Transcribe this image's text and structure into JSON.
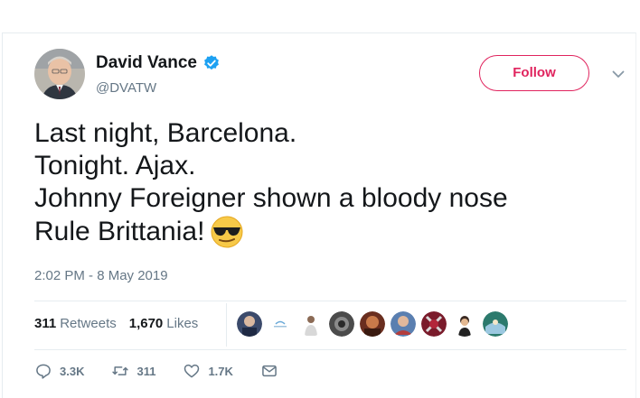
{
  "user": {
    "display_name": "David Vance",
    "handle": "@DVATW"
  },
  "follow_label": "Follow",
  "tweet": {
    "lines": [
      "Last night, Barcelona.",
      "Tonight. Ajax.",
      "Johnny Foreigner shown a bloody nose",
      "Rule Brittania!"
    ],
    "timestamp": "2:02 PM - 8 May 2019"
  },
  "stats": {
    "retweets_count": "311",
    "retweets_label": "Retweets",
    "likes_count": "1,670",
    "likes_label": "Likes"
  },
  "actions": {
    "reply_count": "3.3K",
    "retweet_count": "311",
    "like_count": "1.7K"
  },
  "colors": {
    "follow_accent": "#e0245e",
    "verified": "#1da1f2",
    "secondary_text": "#657786"
  },
  "icons": [
    "verified-icon",
    "chevron-down-icon",
    "sunglasses-emoji",
    "reply-icon",
    "retweet-icon",
    "heart-icon",
    "dm-icon"
  ]
}
